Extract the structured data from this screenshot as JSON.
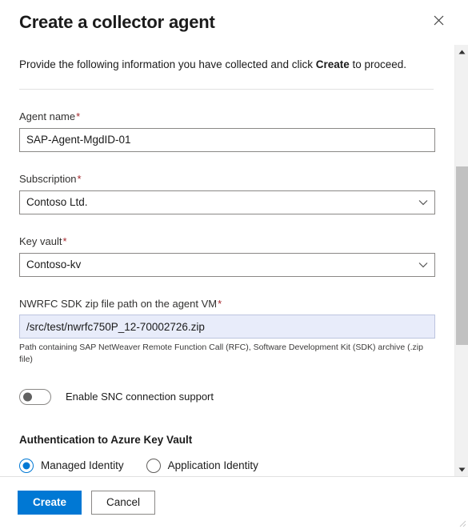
{
  "dialog": {
    "title": "Create a collector agent",
    "close_icon": "close-icon",
    "intro_prefix": "Provide the following information you have collected and click ",
    "intro_bold": "Create",
    "intro_suffix": " to proceed."
  },
  "form": {
    "required_marker": "*",
    "agent_name": {
      "label": "Agent name",
      "value": "SAP-Agent-MgdID-01",
      "required": true
    },
    "subscription": {
      "label": "Subscription",
      "value": "Contoso Ltd.",
      "required": true,
      "chevron_icon": "chevron-down-icon"
    },
    "key_vault": {
      "label": "Key vault",
      "value": "Contoso-kv",
      "required": true,
      "chevron_icon": "chevron-down-icon"
    },
    "nwrfc_path": {
      "label": "NWRFC SDK zip file path on the agent VM",
      "value": "/src/test/nwrfc750P_12-70002726.zip",
      "required": true,
      "helper": "Path containing SAP NetWeaver Remote Function Call (RFC), Software Development Kit (SDK) archive (.zip file)"
    },
    "snc_toggle": {
      "label": "Enable SNC connection support",
      "state": "off"
    },
    "auth_section": {
      "heading": "Authentication to Azure Key Vault",
      "options": [
        {
          "label": "Managed Identity",
          "selected": true
        },
        {
          "label": "Application Identity",
          "selected": false
        }
      ]
    }
  },
  "footer": {
    "create_label": "Create",
    "cancel_label": "Cancel"
  },
  "scrollbar": {
    "up_icon": "scroll-up-arrow-icon",
    "down_icon": "scroll-down-arrow-icon"
  },
  "colors": {
    "accent": "#0078d4",
    "required_red": "#a4262c",
    "input_border": "#8a8886",
    "highlight_fill": "#e8ecfa",
    "scrollbar_thumb": "#c1c1c1"
  }
}
